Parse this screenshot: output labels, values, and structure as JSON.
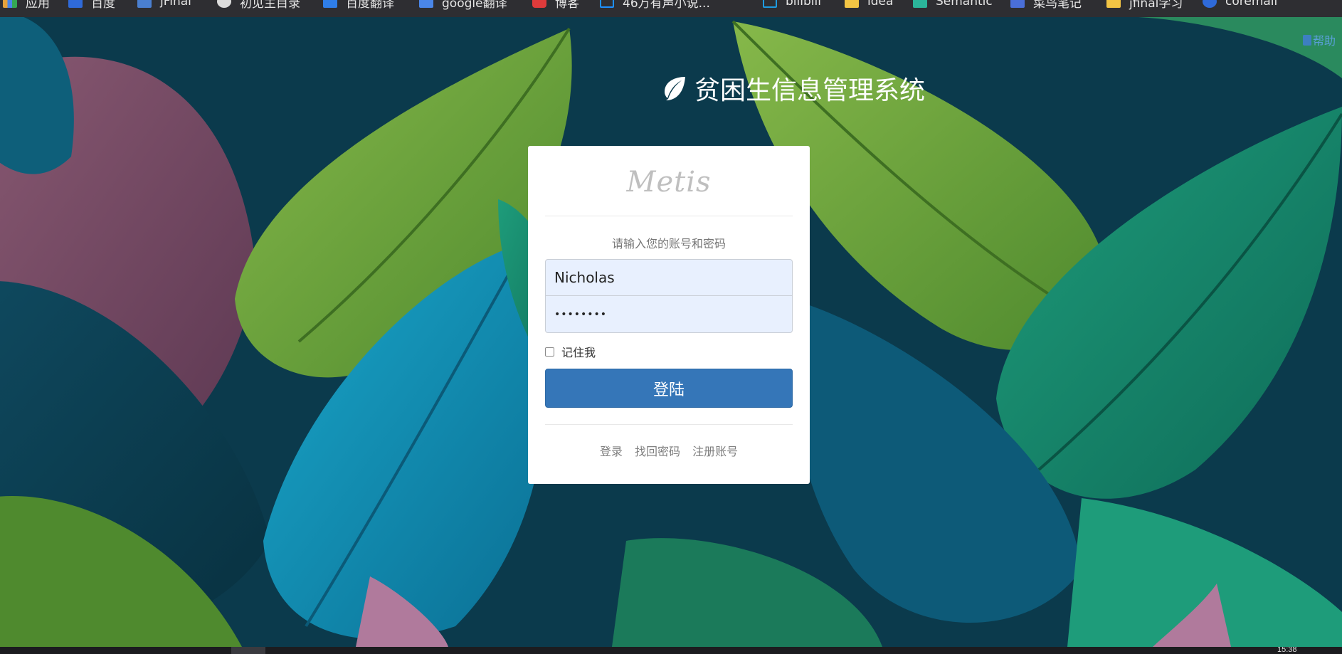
{
  "bookmarks": [
    {
      "label": "应用",
      "icon": "apps-grid-icon",
      "color": "#e6a23c"
    },
    {
      "label": "百度",
      "icon": "baidu-icon",
      "color": "#2f6ad9"
    },
    {
      "label": "jFinal",
      "icon": "jfinal-icon",
      "color": "#4a7fd0"
    },
    {
      "label": "初见主目录",
      "icon": "globe-icon",
      "color": "#dddddd"
    },
    {
      "label": "百度翻译",
      "icon": "translate-icon",
      "color": "#2f7ee8"
    },
    {
      "label": "google翻译",
      "icon": "google-translate-icon",
      "color": "#4a86e8"
    },
    {
      "label": "博客",
      "icon": "blog-icon",
      "color": "#e03b3b"
    },
    {
      "label": "46万有声小说...",
      "icon": "page-icon",
      "color": "#1e90ff"
    },
    {
      "label": "bilibili",
      "icon": "bilibili-icon",
      "color": "#1e9be0"
    },
    {
      "label": "idea",
      "icon": "folder-icon",
      "color": "#f3c544"
    },
    {
      "label": "Semantic",
      "icon": "semantic-icon",
      "color": "#2bb59a"
    },
    {
      "label": "菜鸟笔记",
      "icon": "notes-icon",
      "color": "#4a6fd8"
    },
    {
      "label": "jfinal学习",
      "icon": "folder-icon",
      "color": "#f3c544"
    },
    {
      "label": "coremail",
      "icon": "coremail-icon",
      "color": "#2f6ad9"
    }
  ],
  "help": {
    "label": "帮助"
  },
  "header": {
    "title": "贫困生信息管理系统"
  },
  "login": {
    "logo_text": "Metis",
    "prompt": "请输入您的账号和密码",
    "username_value": "Nicholas",
    "password_masked": "••••••••",
    "remember_label": "记住我",
    "submit_label": "登陆",
    "links": {
      "login": "登录",
      "recover": "找回密码",
      "register": "注册账号"
    }
  },
  "taskbar": {
    "clock": "15:38"
  },
  "colors": {
    "primary_button": "#3576b8",
    "input_fill": "#e8f0fe",
    "help_link": "#5aa0d8"
  }
}
